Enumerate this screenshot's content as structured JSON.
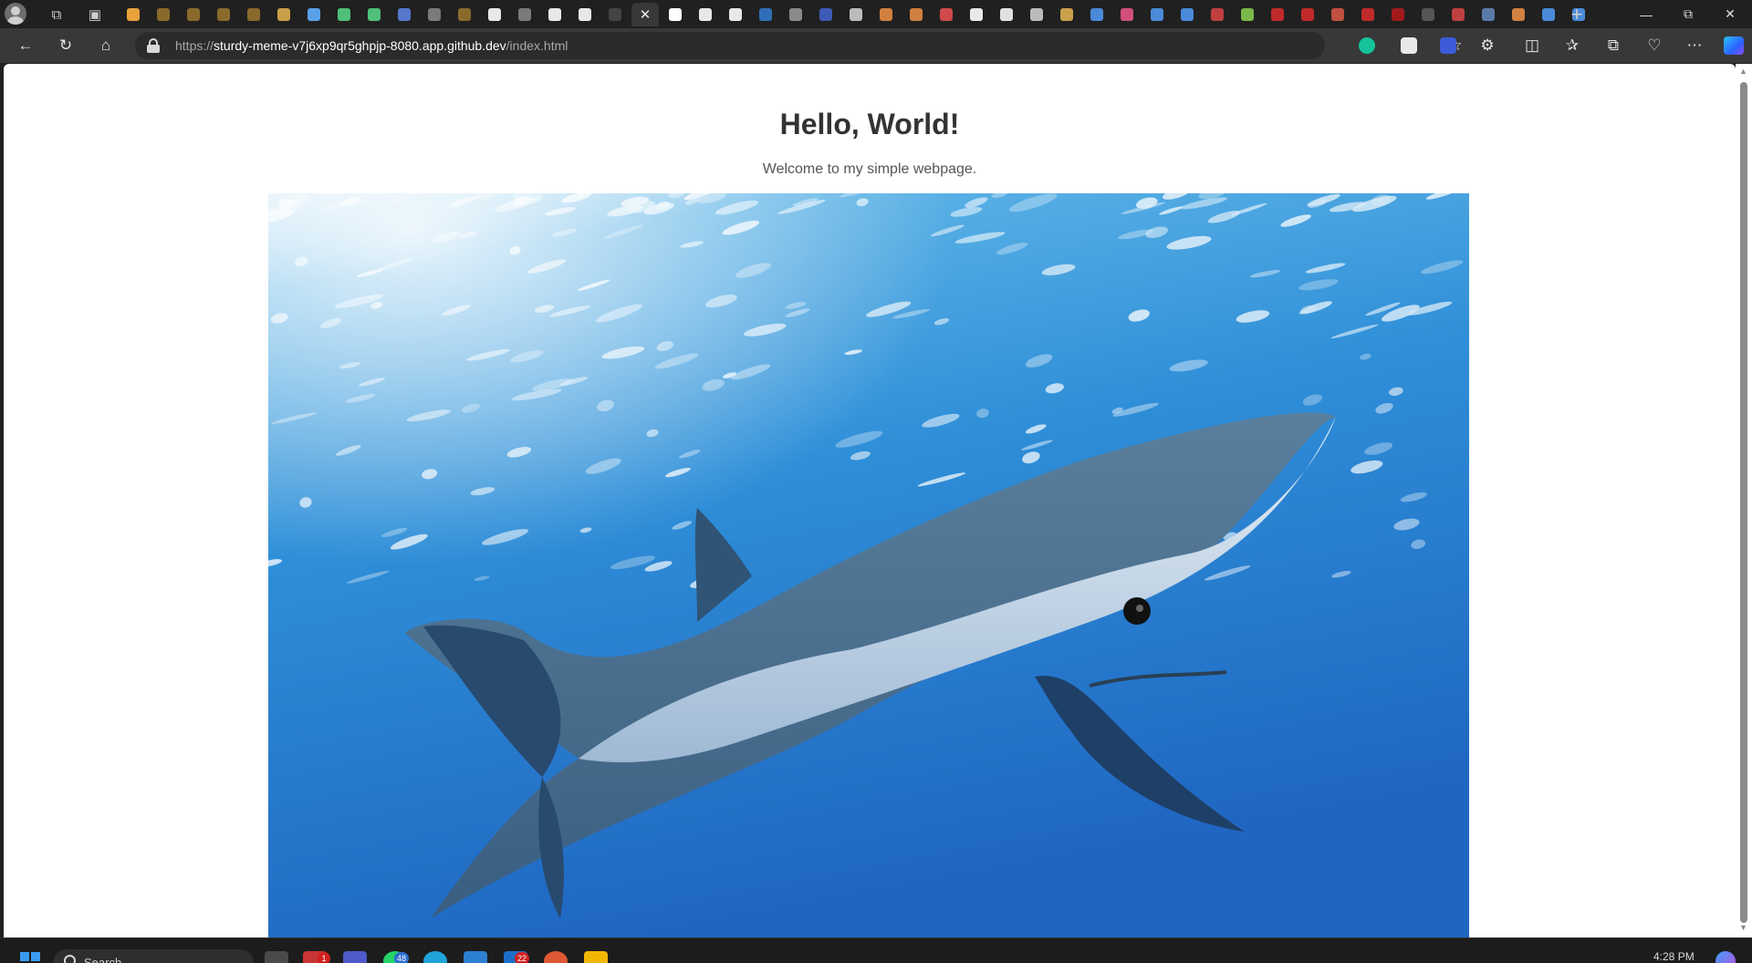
{
  "browser": {
    "address": {
      "scheme": "https://",
      "host": "sturdy-meme-v7j6xp9qr5ghpjp-8080.app.github.dev",
      "path": "/index.html"
    },
    "toolbar_icons": [
      "back-icon",
      "refresh-icon",
      "home-icon",
      "lock-icon",
      "read-aloud-icon",
      "favorite-icon",
      "grammarly-icon",
      "extension-icon",
      "extensions-icon",
      "split-screen-icon",
      "favorites-icon",
      "collections-icon",
      "performance-icon",
      "more-icon",
      "copilot-icon"
    ],
    "tab_favicon_colors": [
      "#e8a13a",
      "#8a6a2c",
      "#8a6a2c",
      "#8a6a2c",
      "#8a6a2c",
      "#c9a04a",
      "#5aa0e8",
      "#4fbf7a",
      "#4fbf7a",
      "#5577cc",
      "#7a7a7a",
      "#8a6a2c",
      "#e8e8e8",
      "#7a7a7a",
      "#e8e8e8",
      "#e8e8e8",
      "#444444"
    ],
    "tab_favicon_colors_after": [
      "#ffffff",
      "#e8e8e8",
      "#e8e8e8",
      "#2f6fb8",
      "#8a8a8a",
      "#3d5bb5",
      "#bbbbbb",
      "#d08040",
      "#d08040",
      "#d04a4a",
      "#e8e8e8",
      "#e0e0e0",
      "#bbbbbb",
      "#c9a04a",
      "#4a8ad8",
      "#d0507a",
      "#4a8ad8",
      "#4a8ad8",
      "#c04040",
      "#7ab84a",
      "#c02a2a",
      "#c02a2a",
      "#c05040",
      "#c02a2a",
      "#a01a1a",
      "#555555",
      "#c04040",
      "#5a7aa8",
      "#d08040",
      "#4a8ad8",
      "#4a8ad8"
    ]
  },
  "page": {
    "heading": "Hello, World!",
    "subheading": "Welcome to my simple webpage."
  },
  "taskbar": {
    "search_placeholder": "Search",
    "badges": {
      "mail": "1",
      "whatsapp": "48",
      "outlook": "22"
    },
    "clock": "4:28 PM"
  }
}
